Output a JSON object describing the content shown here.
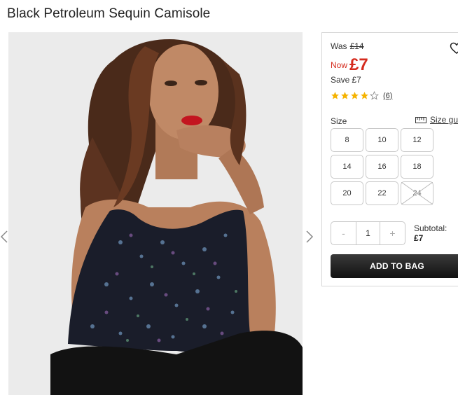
{
  "product": {
    "title": "Black Petroleum Sequin Camisole",
    "image_icon": "model-photo"
  },
  "gallery": {
    "prev_icon": "chevron-left-icon",
    "next_icon": "chevron-right-icon"
  },
  "pricing": {
    "was_label": "Was",
    "was_price": "£14",
    "now_label": "Now",
    "now_price": "£7",
    "save_label": "Save",
    "save_price": "£7",
    "sale_color": "#d52b1e"
  },
  "rating": {
    "stars": 4,
    "out_of": 5,
    "review_count": "(6)",
    "star_color": "#f5b301"
  },
  "size": {
    "label": "Size",
    "guide_label": "Size guide",
    "options": [
      {
        "label": "8",
        "available": true
      },
      {
        "label": "10",
        "available": true
      },
      {
        "label": "12",
        "available": true
      },
      {
        "label": "14",
        "available": true
      },
      {
        "label": "16",
        "available": true
      },
      {
        "label": "18",
        "available": true
      },
      {
        "label": "20",
        "available": true
      },
      {
        "label": "22",
        "available": true
      },
      {
        "label": "24",
        "available": false
      }
    ]
  },
  "quantity": {
    "minus": "-",
    "value": "1",
    "plus": "+"
  },
  "subtotal": {
    "label": "Subtotal:",
    "value": "£7"
  },
  "cart": {
    "add_label": "ADD TO BAG"
  }
}
